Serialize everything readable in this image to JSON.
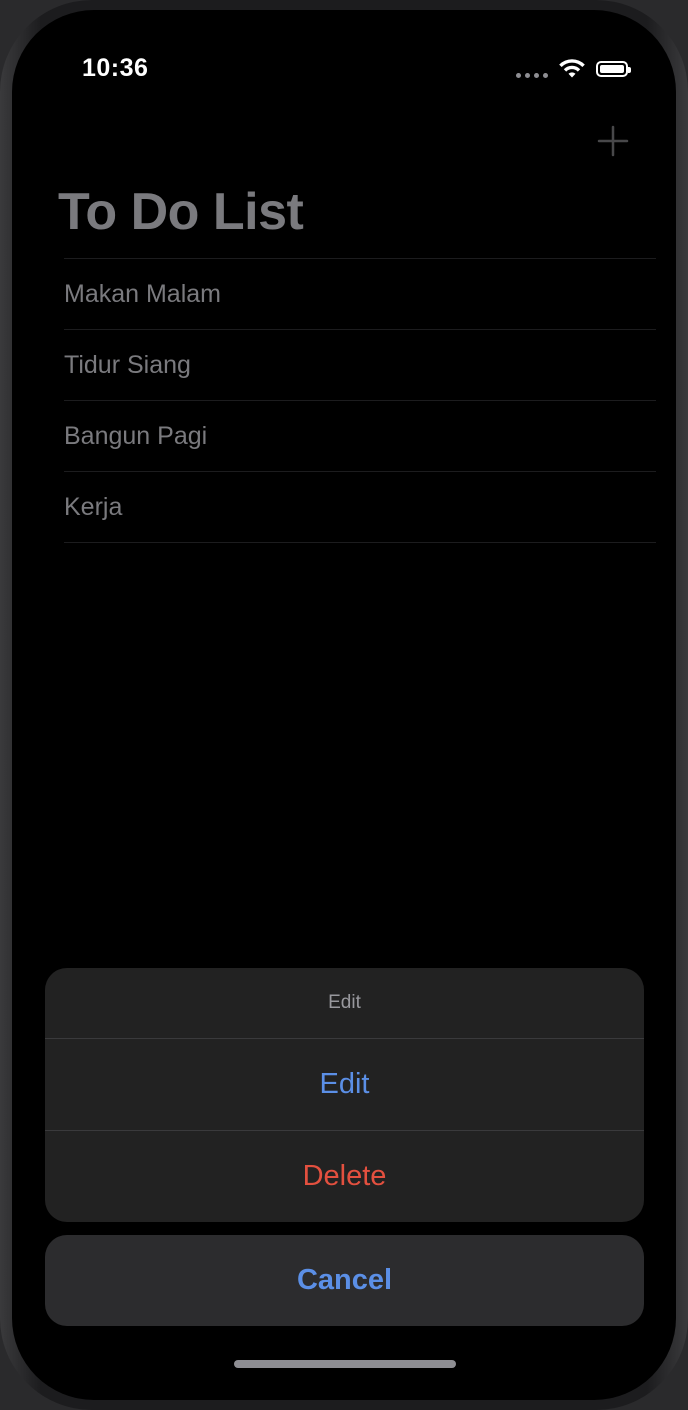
{
  "status_bar": {
    "time": "10:36",
    "wifi_icon": "wifi-icon",
    "battery_icon": "battery-icon",
    "signal_icon": "signal-dots-icon"
  },
  "nav": {
    "add_icon": "plus-icon"
  },
  "title": "To Do List",
  "todos": [
    "Makan Malam",
    "Tidur Siang",
    "Bangun Pagi",
    "Kerja"
  ],
  "action_sheet": {
    "header": "Edit",
    "edit_label": "Edit",
    "delete_label": "Delete",
    "cancel_label": "Cancel"
  },
  "colors": {
    "accent_blue": "#5b8fe6",
    "destructive_red": "#e3503f",
    "background": "#000000"
  }
}
